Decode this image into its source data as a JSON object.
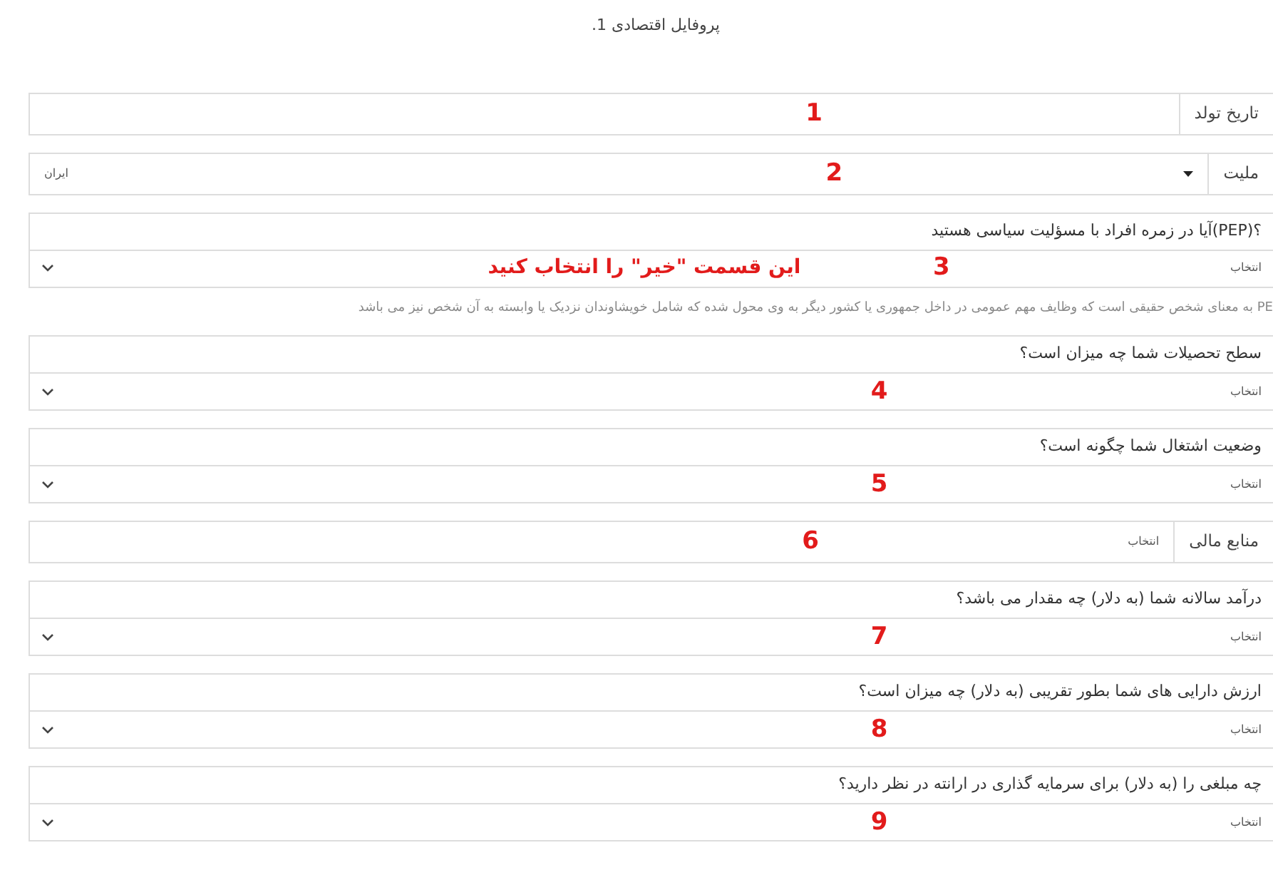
{
  "title": "پروفایل اقتصادی 1.",
  "fields": [
    {
      "kind": "addon-input",
      "label": "تاریخ تولد",
      "note": "1"
    },
    {
      "kind": "addon-select",
      "label": "ملیت",
      "value": "ایران",
      "note": "2"
    },
    {
      "kind": "question",
      "label": "؟(PEP)آیا در زمره افراد با مسؤلیت سیاسی هستید",
      "placeholder": "انتخاب",
      "note": "3",
      "instruction": "این قسمت \"خیر\" را انتخاب کنید",
      "help": "PE به معنای شخص حقیقی است که وظایف مهم عمومی در داخل جمهوری یا کشور دیگر به وی محول شده که شامل خویشاوندان نزدیک یا وابسته به آن شخص نیز می باشد"
    },
    {
      "kind": "question",
      "label": "سطح تحصیلات شما چه میزان است؟",
      "placeholder": "انتخاب",
      "note": "4"
    },
    {
      "kind": "question",
      "label": "وضعیت اشتغال شما چگونه است؟",
      "placeholder": "انتخاب",
      "note": "5"
    },
    {
      "kind": "addon-plain",
      "label": "منابع مالی",
      "value": "انتخاب",
      "note": "6"
    },
    {
      "kind": "question",
      "label": "درآمد سالانه شما (به دلار) چه مقدار می باشد؟",
      "placeholder": "انتخاب",
      "note": "7"
    },
    {
      "kind": "question",
      "label": "ارزش دارایی های شما بطور تقریبی (به دلار) چه میزان است؟",
      "placeholder": "انتخاب",
      "note": "8"
    },
    {
      "kind": "question",
      "label": "چه مبلغی را (به دلار) برای سرمایه گذاری در ارانته در نظر دارید؟",
      "placeholder": "انتخاب",
      "note": "9"
    }
  ]
}
